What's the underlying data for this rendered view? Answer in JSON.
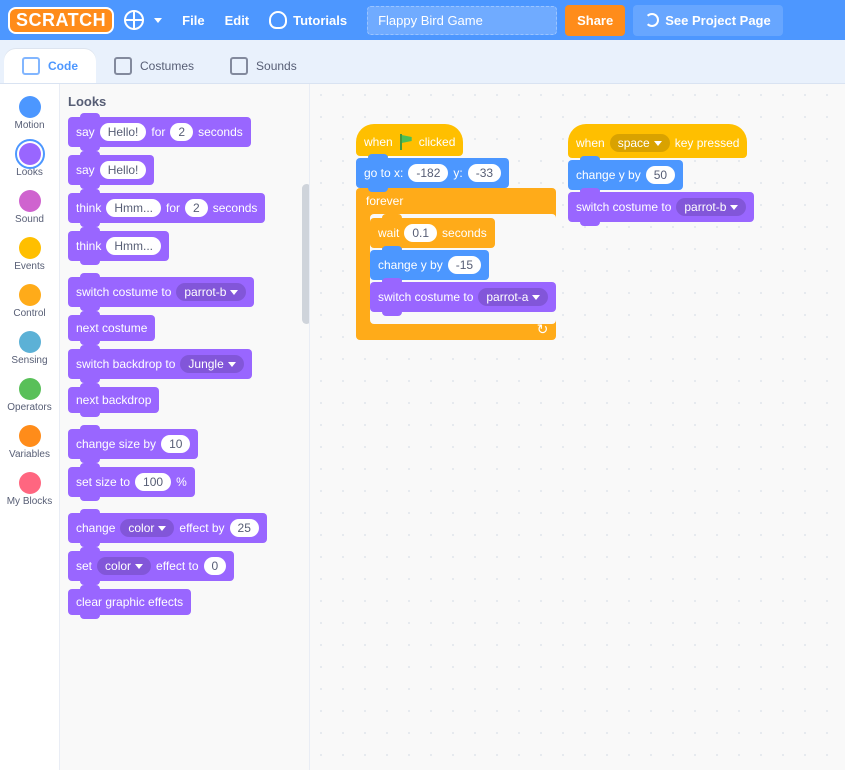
{
  "menubar": {
    "logo_text": "SCRATCH",
    "file": "File",
    "edit": "Edit",
    "tutorials": "Tutorials",
    "project_title": "Flappy Bird Game",
    "share": "Share",
    "see_project": "See Project Page"
  },
  "tabs": {
    "code": "Code",
    "costumes": "Costumes",
    "sounds": "Sounds"
  },
  "categories": [
    {
      "name": "Motion",
      "color": "#4c97ff"
    },
    {
      "name": "Looks",
      "color": "#9966ff"
    },
    {
      "name": "Sound",
      "color": "#cf63cf"
    },
    {
      "name": "Events",
      "color": "#ffbf00"
    },
    {
      "name": "Control",
      "color": "#ffab19"
    },
    {
      "name": "Sensing",
      "color": "#5cb1d6"
    },
    {
      "name": "Operators",
      "color": "#59c059"
    },
    {
      "name": "Variables",
      "color": "#ff8c1a"
    },
    {
      "name": "My Blocks",
      "color": "#ff6680"
    }
  ],
  "palette": {
    "heading": "Looks",
    "blocks": {
      "say_for_1": "say",
      "say_for_val": "Hello!",
      "say_for_2": "for",
      "say_for_secs": "2",
      "say_for_3": "seconds",
      "say_1": "say",
      "say_val": "Hello!",
      "think_for_1": "think",
      "think_for_val": "Hmm...",
      "think_for_2": "for",
      "think_for_secs": "2",
      "think_for_3": "seconds",
      "think_1": "think",
      "think_val": "Hmm...",
      "switch_costume": "switch costume to",
      "switch_costume_val": "parrot-b",
      "next_costume": "next costume",
      "switch_backdrop": "switch backdrop to",
      "switch_backdrop_val": "Jungle",
      "next_backdrop": "next backdrop",
      "change_size": "change size by",
      "change_size_val": "10",
      "set_size": "set size to",
      "set_size_val": "100",
      "set_size_pct": "%",
      "change_effect_1": "change",
      "change_effect_dd": "color",
      "change_effect_2": "effect by",
      "change_effect_val": "25",
      "set_effect_1": "set",
      "set_effect_dd": "color",
      "set_effect_2": "effect to",
      "set_effect_val": "0",
      "clear_effects": "clear graphic effects"
    }
  },
  "workspace": {
    "stack1": {
      "when_clicked": "when",
      "clicked_2": "clicked",
      "goto_1": "go to x:",
      "goto_x": "-182",
      "goto_2": "y:",
      "goto_y": "-33",
      "forever": "forever",
      "wait_1": "wait",
      "wait_val": "0.1",
      "wait_2": "seconds",
      "change_y_1": "change y by",
      "change_y_val": "-15",
      "switch_costume": "switch costume to",
      "switch_costume_val": "parrot-a"
    },
    "stack2": {
      "when_key_1": "when",
      "when_key_val": "space",
      "when_key_2": "key pressed",
      "change_y_1": "change y by",
      "change_y_val": "50",
      "switch_costume": "switch costume to",
      "switch_costume_val": "parrot-b"
    }
  }
}
